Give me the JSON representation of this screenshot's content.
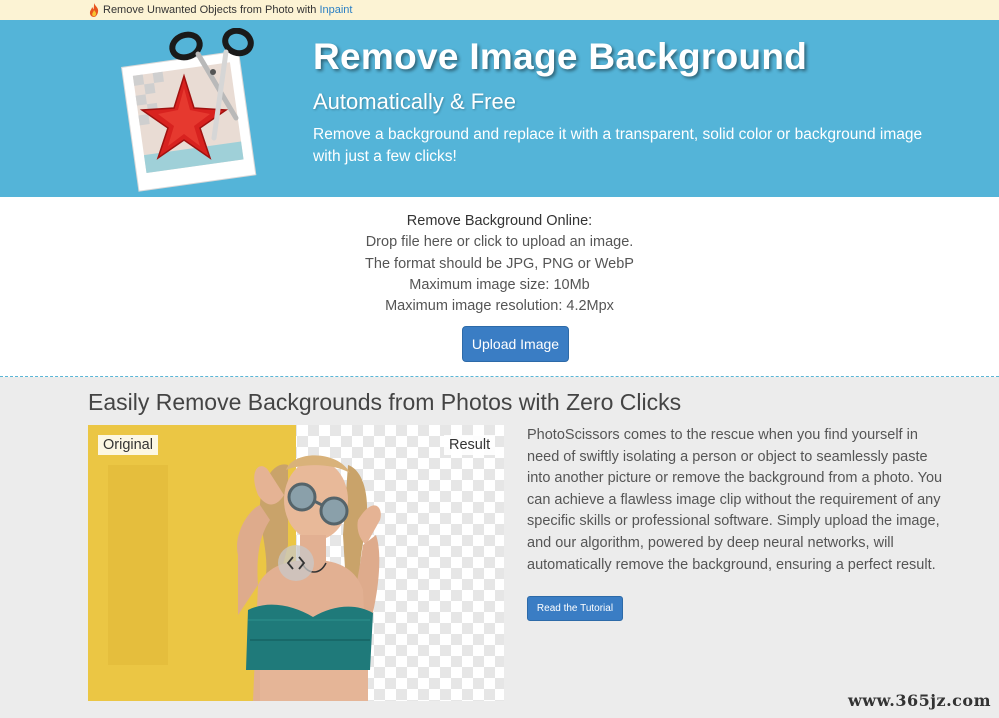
{
  "topbar": {
    "promo_text": "Remove Unwanted Objects from Photo with ",
    "promo_link": "Inpaint",
    "icon": "fire-icon"
  },
  "hero": {
    "title": "Remove Image Background",
    "subtitle": "Automatically & Free",
    "description": "Remove a background and replace it with a transparent, solid color or background image with just a few clicks!",
    "logo": "photoscissors-logo"
  },
  "upload": {
    "title": "Remove Background Online:",
    "line1": "Drop file here or click to upload an image.",
    "line2": "The format should be JPG, PNG or WebP",
    "line3": "Maximum image size: 10Mb",
    "line4": "Maximum image resolution: 4.2Mpx",
    "button_label": "Upload Image"
  },
  "feature": {
    "title": "Easily Remove Backgrounds from Photos with Zero Clicks",
    "original_label": "Original",
    "result_label": "Result",
    "description": "PhotoScissors comes to the rescue when you find yourself in need of swiftly isolating a person or object to seamlessly paste into another picture or remove the background from a photo. You can achieve a flawless image clip without the requirement of any specific skills or professional software. Simply upload the image, and our algorithm, powered by deep neural networks, will automatically remove the background, ensuring a perfect result.",
    "tutorial_button": "Read the Tutorial",
    "slider_icon": "chevron-left-right-icon"
  },
  "watermark": "www.365jz.com",
  "colors": {
    "hero_bg": "#54b4d8",
    "button_bg": "#3a7dc4",
    "topbar_bg": "#fcf3d4",
    "link": "#2a7fc4"
  }
}
